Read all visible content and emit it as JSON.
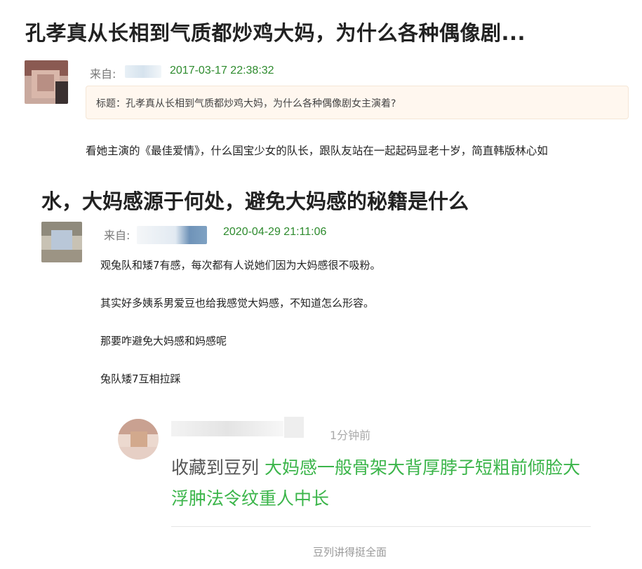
{
  "post1": {
    "title": "孔孝真从长相到气质都炒鸡大妈，为什么各种偶像剧...",
    "from_label": "来自:",
    "date": "2017-03-17 22:38:32",
    "quote": "标题：孔孝真从长相到气质都炒鸡大妈，为什么各种偶像剧女主演着?",
    "body": "看她主演的《最佳爱情》，什么国宝少女的队长，跟队友站在一起起码显老十岁，简直韩版林心如"
  },
  "post2": {
    "title": "水，大妈感源于何处，避免大妈感的秘籍是什么",
    "from_label": "来自:",
    "date": "2020-04-29 21:11:06",
    "lines": [
      "观兔队和矮7有感，每次都有人说她们因为大妈感很不吸粉。",
      "其实好多姨系男爱豆也给我感觉大妈感，不知道怎么形容。",
      "那要咋避免大妈感和妈感呢",
      "兔队矮7互相拉踩"
    ]
  },
  "comment": {
    "time": "1分钟前",
    "prefix": "收藏到豆列",
    "text": "大妈感一般骨架大背厚脖子短粗前倾脸大浮肿法令纹重人中长"
  },
  "footer": "豆列讲得挺全面",
  "colors": {
    "date_green": "#2e8b2e",
    "comment_green": "#3bb54a",
    "quote_bg": "#fff7ef"
  }
}
